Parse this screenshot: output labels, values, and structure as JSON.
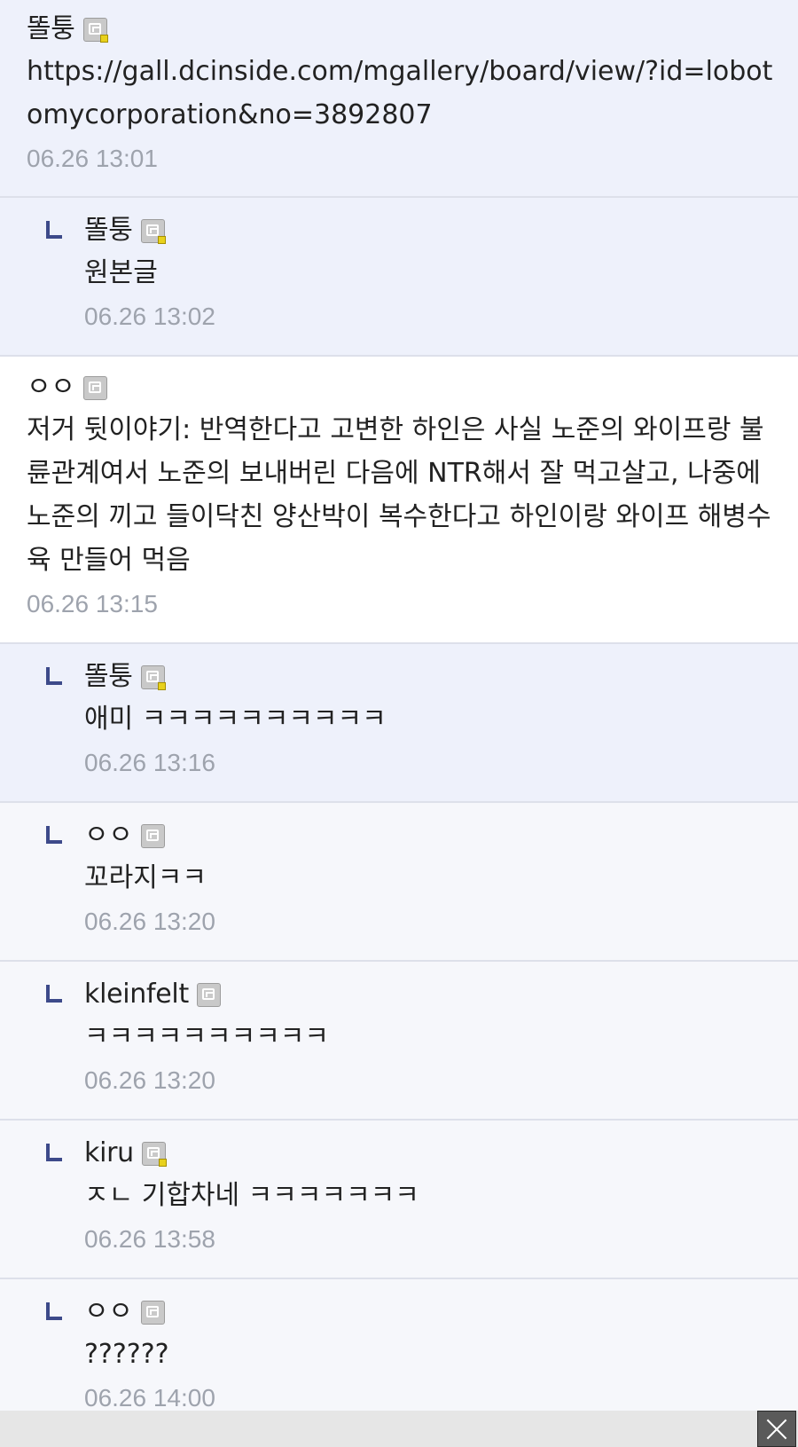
{
  "comments": [
    {
      "nick": "똘퉁",
      "icon": "gallery-manager-icon",
      "text": "https://gall.dcinside.com/mgallery/board/view/?id=lobotomycorporation&no=3892807",
      "date": "06.26 13:01"
    },
    {
      "nick": "똘퉁",
      "icon": "gallery-manager-icon",
      "text": "원본글",
      "date": "06.26 13:02"
    },
    {
      "nick": "ㅇㅇ",
      "icon": "gallery-user-icon",
      "text": "저거 뒷이야기: 반역한다고 고변한 하인은 사실 노준의 와이프랑 불륜관계여서 노준의 보내버린 다음에 NTR해서 잘 먹고살고, 나중에 노준의 끼고 들이닥친 양산박이 복수한다고 하인이랑 와이프 해병수육 만들어 먹음",
      "date": "06.26 13:15"
    },
    {
      "nick": "똘퉁",
      "icon": "gallery-manager-icon",
      "text": "애미 ㅋㅋㅋㅋㅋㅋㅋㅋㅋㅋ",
      "date": "06.26 13:16"
    },
    {
      "nick": "ㅇㅇ",
      "icon": "gallery-user-icon",
      "text": "꼬라지ㅋㅋ",
      "date": "06.26 13:20"
    },
    {
      "nick": "kleinfelt",
      "icon": "gallery-user-icon",
      "text": "ㅋㅋㅋㅋㅋㅋㅋㅋㅋㅋ",
      "date": "06.26 13:20"
    },
    {
      "nick": "kiru",
      "icon": "gallery-manager-icon",
      "text": "ㅈㄴ 기합차네 ㅋㅋㅋㅋㅋㅋㅋ",
      "date": "06.26 13:58"
    },
    {
      "nick": "ㅇㅇ",
      "icon": "gallery-user-icon",
      "text": "??????",
      "date": "06.26 14:00"
    }
  ]
}
